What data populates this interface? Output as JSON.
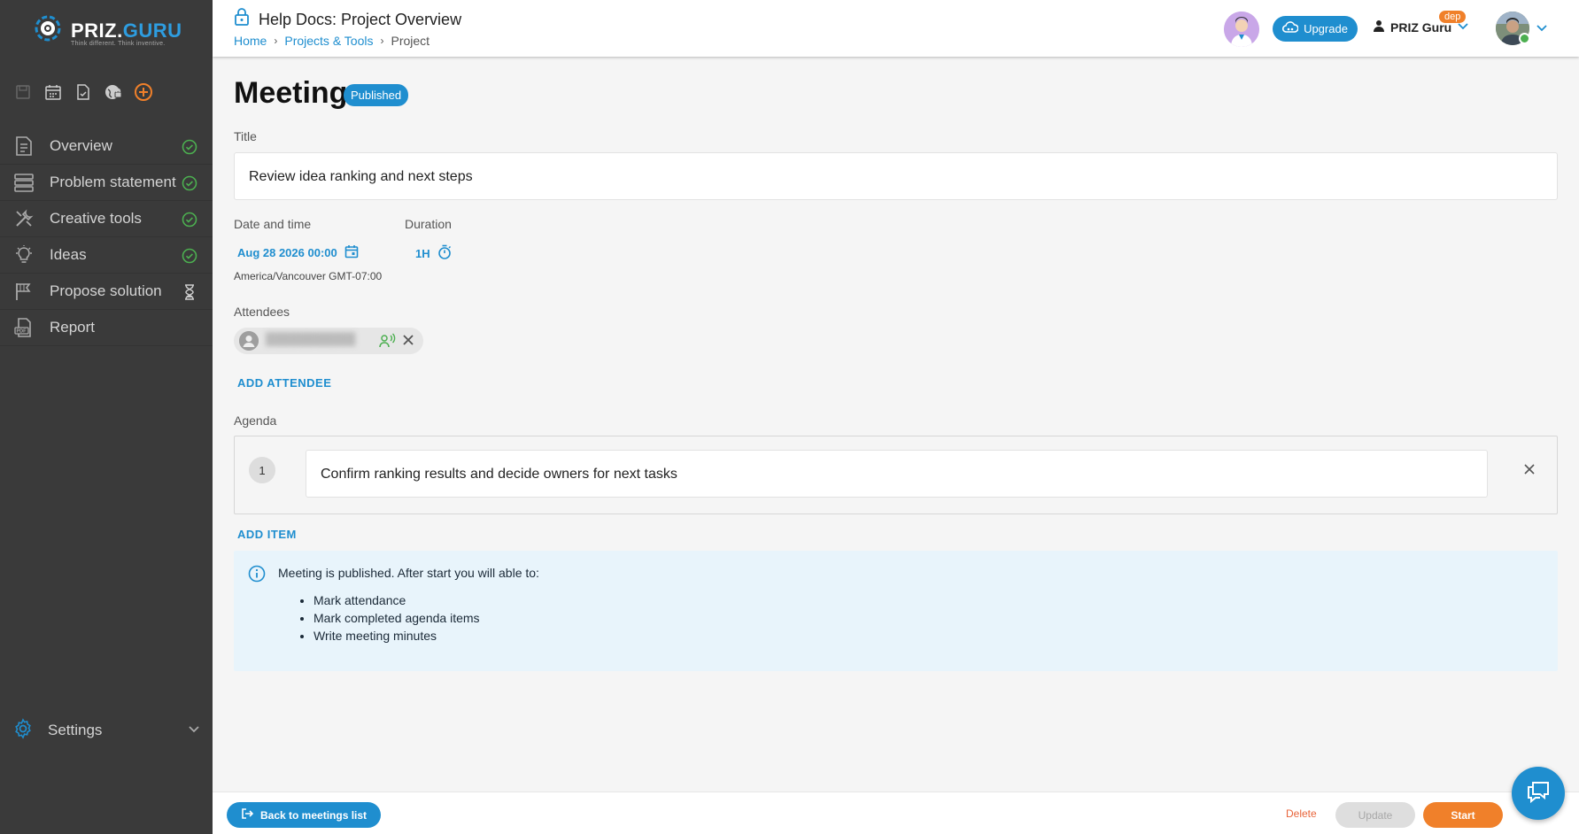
{
  "brand": {
    "logo_main": "PRIZ.",
    "logo_accent": "GURU",
    "tagline": "Think different. Think inventive."
  },
  "sidebar": {
    "quick_icons": [
      "save-icon",
      "calendar-icon",
      "task-doc-icon",
      "globe-lock-icon",
      "add-circle-icon"
    ],
    "items": [
      {
        "label": "Overview",
        "icon": "document-icon",
        "status": "done"
      },
      {
        "label": "Problem statement",
        "icon": "stack-icon",
        "status": "done"
      },
      {
        "label": "Creative tools",
        "icon": "tools-icon",
        "status": "done"
      },
      {
        "label": "Ideas",
        "icon": "lightbulb-icon",
        "status": "done"
      },
      {
        "label": "Propose solution",
        "icon": "flag-icon",
        "status": "pending"
      },
      {
        "label": "Report",
        "icon": "pdf-icon",
        "status": "none"
      }
    ],
    "settings_label": "Settings"
  },
  "topbar": {
    "title": "Help Docs: Project Overview",
    "breadcrumb": {
      "home": "Home",
      "projects": "Projects & Tools",
      "current": "Project"
    },
    "upgrade_label": "Upgrade",
    "user_name": "PRIZ Guru",
    "env_badge": "dep"
  },
  "meeting": {
    "heading": "Meeting",
    "status": "Published",
    "title_label": "Title",
    "title_value": "Review idea ranking and next steps",
    "datetime_label": "Date and time",
    "datetime_value": "Aug 28 2026 00:00",
    "timezone": "America/Vancouver GMT-07:00",
    "duration_label": "Duration",
    "duration_value": "1H",
    "attendees_label": "Attendees",
    "attendee_name": "███████████",
    "add_attendee_label": "ADD ATTENDEE",
    "agenda_label": "Agenda",
    "agenda_items": [
      {
        "number": "1",
        "text": "Confirm ranking results and decide owners for next tasks"
      }
    ],
    "add_item_label": "ADD ITEM",
    "info_text": "Meeting is published. After start you will able to:",
    "info_list": [
      "Mark attendance",
      "Mark completed agenda items",
      "Write meeting minutes"
    ]
  },
  "footer": {
    "back_label": "Back to meetings list",
    "delete_label": "Delete",
    "update_label": "Update",
    "start_label": "Start"
  },
  "colors": {
    "accent": "#1f8ecf",
    "orange": "#f0802a",
    "sidebar_bg": "#3a3a3a",
    "success": "#4caf50"
  }
}
